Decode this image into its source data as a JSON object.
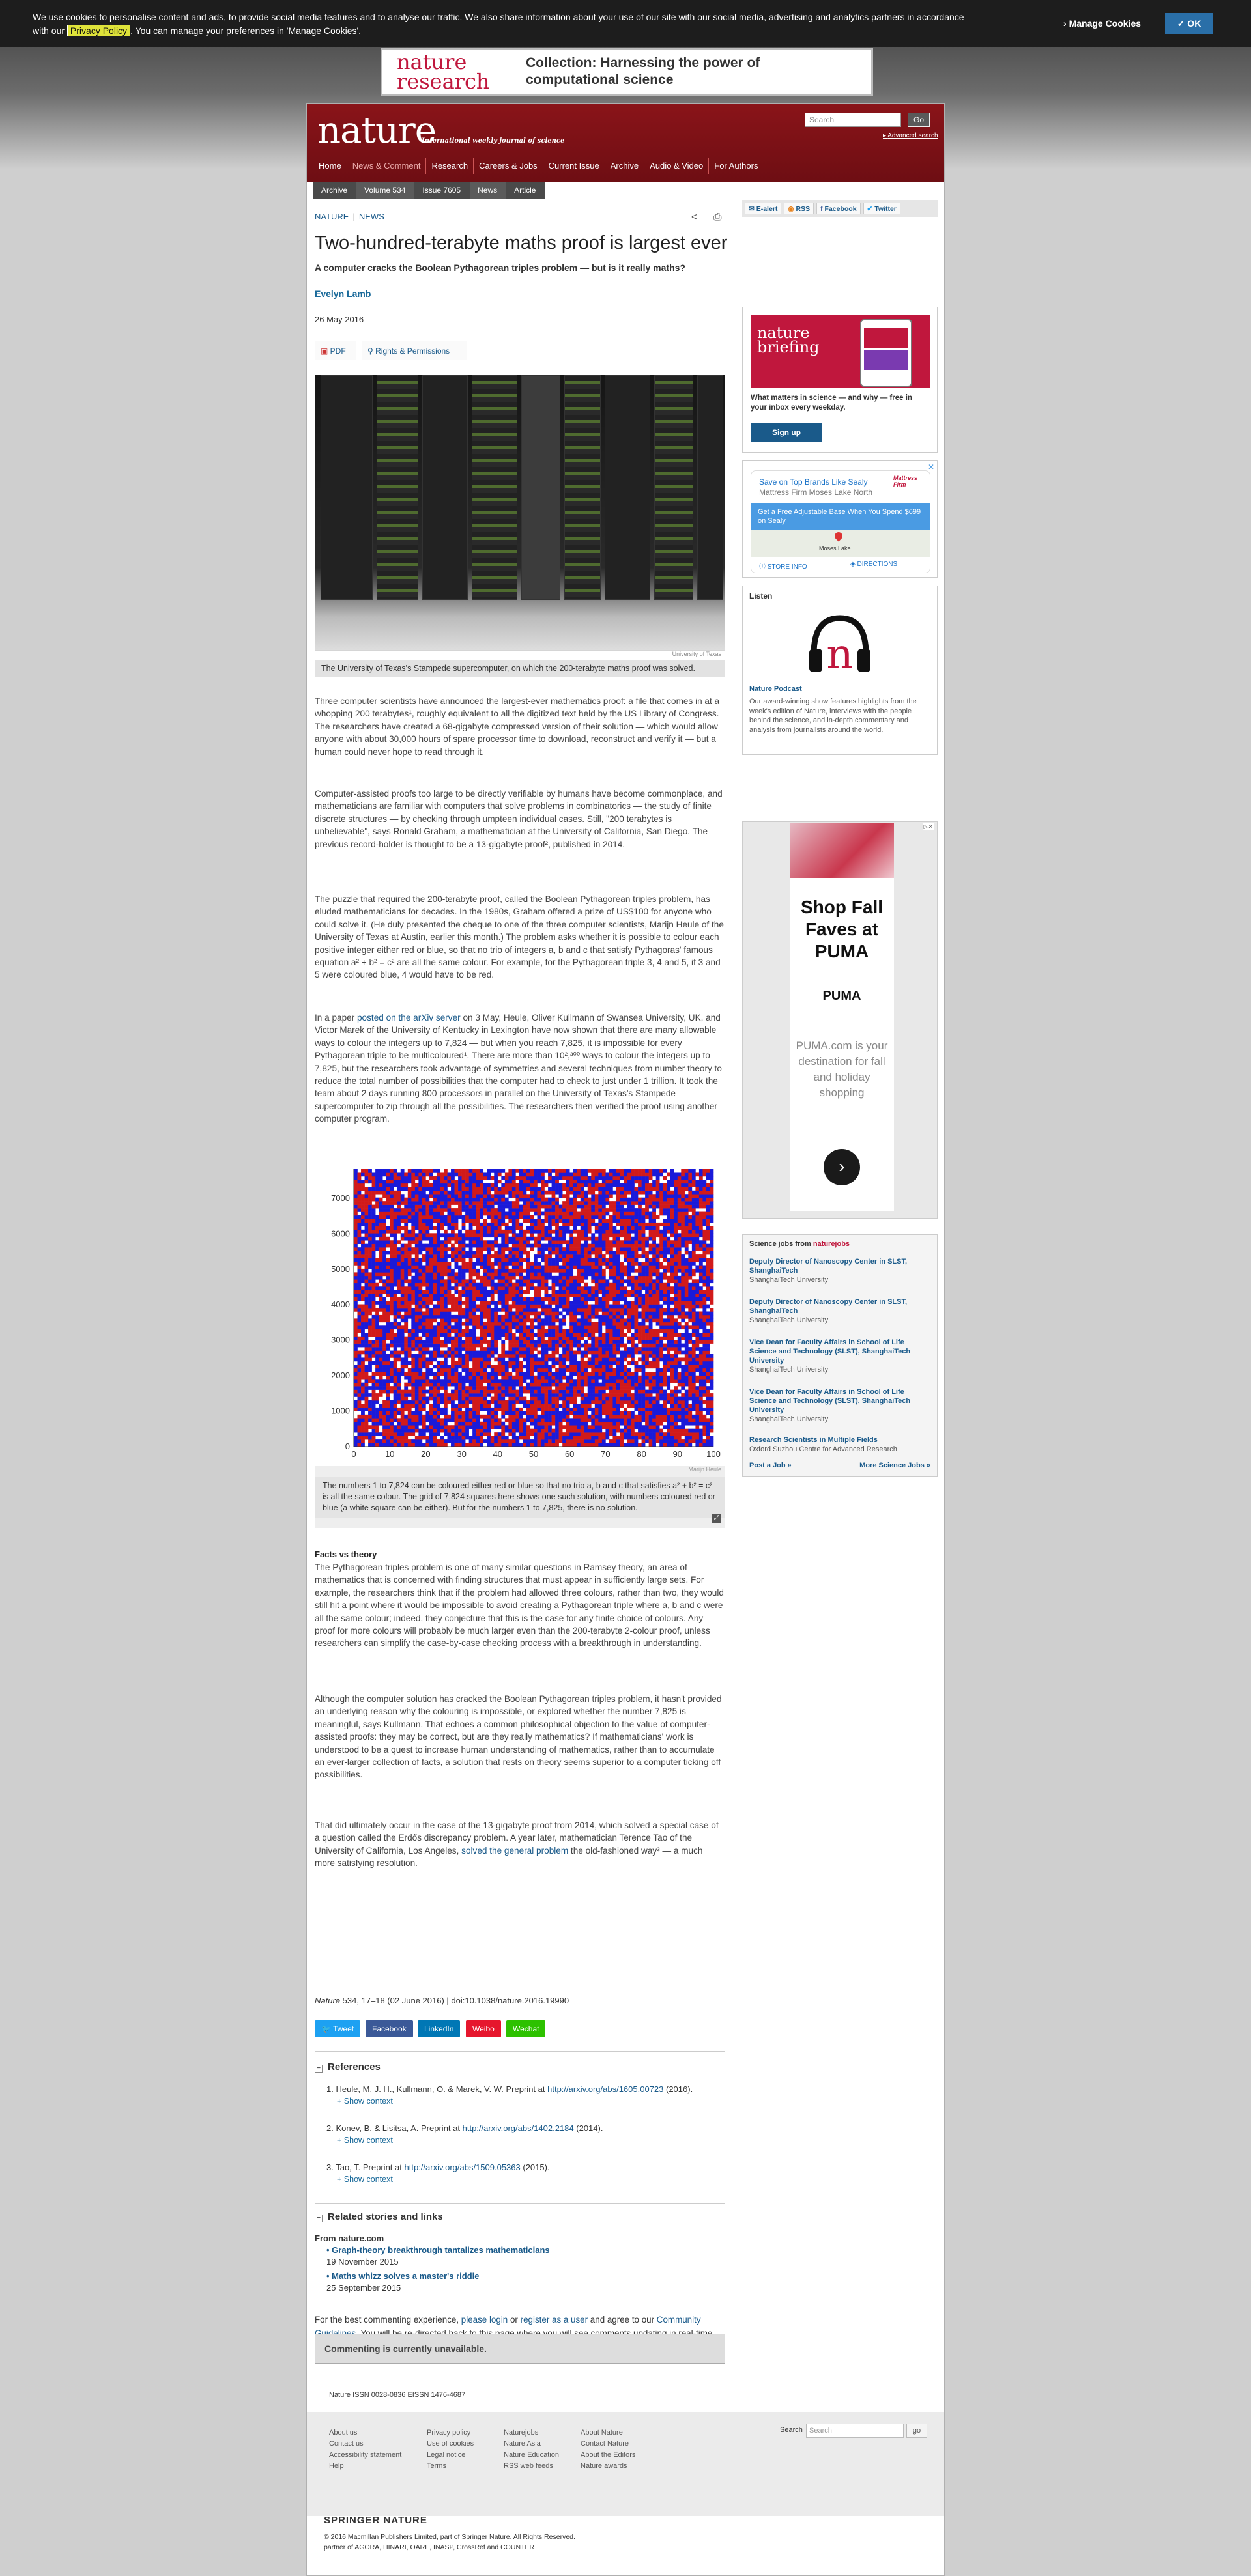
{
  "cookie": {
    "text_before": "We use cookies to personalise content and ads, to provide social media features and to analyse our traffic. We also share information about your use of our site with our social media, advertising and analytics partners in accordance with our ",
    "privacy_link": "Privacy Policy",
    "text_after": ". You can manage your preferences in 'Manage Cookies'.",
    "manage": "Manage Cookies",
    "ok": "✓ OK"
  },
  "banner": {
    "logo_line1": "nature",
    "logo_line2": "research",
    "message": "Collection: Harnessing the power of computational science"
  },
  "masthead": {
    "logo": "nature",
    "tagline": "International weekly journal of science",
    "search_placeholder": "Search",
    "go": "Go",
    "advanced": "Advanced search"
  },
  "nav": [
    "Home",
    "News & Comment",
    "Research",
    "Careers & Jobs",
    "Current Issue",
    "Archive",
    "Audio & Video",
    "For Authors"
  ],
  "breadcrumbs": [
    "Archive",
    "Volume 534",
    "Issue 7605",
    "News",
    "Article"
  ],
  "article": {
    "kicker1": "NATURE",
    "kicker2": "NEWS",
    "title": "Two-hundred-terabyte maths proof is largest ever",
    "standfirst": "A computer cracks the Boolean Pythagorean triples problem — but is it really maths?",
    "author": "Evelyn Lamb",
    "date": "26 May 2016",
    "pdf": "PDF",
    "rights": "Rights & Permissions",
    "image_credit": "University of Texas",
    "image_caption": "The University of Texas's Stampede supercomputer, on which the 200-terabyte maths proof was solved.",
    "p1": "Three computer scientists have announced the largest-ever mathematics proof: a file that comes in at a whopping 200 terabytes¹, roughly equivalent to all the digitized text held by the US Library of Congress. The researchers have created a 68-gigabyte compressed version of their solution — which would allow anyone with about 30,000 hours of spare processor time to download, reconstruct and verify it — but a human could never hope to read through it.",
    "p2": "Computer-assisted proofs too large to be directly verifiable by humans have become commonplace, and mathematicians are familiar with computers that solve problems in combinatorics — the study of finite discrete structures — by checking through umpteen individual cases. Still, \"200 terabytes is unbelievable\", says Ronald Graham, a mathematician at the University of California, San Diego. The previous record-holder is thought to be a 13-gigabyte proof², published in 2014.",
    "p3": "The puzzle that required the 200-terabyte proof, called the Boolean Pythagorean triples problem, has eluded mathematicians for decades. In the 1980s, Graham offered a prize of US$100 for anyone who could solve it. (He duly presented the cheque to one of the three computer scientists, Marijn Heule of the University of Texas at Austin, earlier this month.) The problem asks whether it is possible to colour each positive integer either red or blue, so that no trio of integers a, b and c that satisfy Pythagoras' famous equation a² + b² = c² are all the same colour. For example, for the Pythagorean triple 3, 4 and 5, if 3 and 5 were coloured blue, 4 would have to be red.",
    "p4_pre": "In a paper ",
    "p4_link": "posted on the arXiv server",
    "p4_post": " on 3 May, Heule, Oliver Kullmann of Swansea University, UK, and Victor Marek of the University of Kentucky in Lexington have now shown that there are many allowable ways to colour the integers up to 7,824 — but when you reach 7,825, it is impossible for every Pythagorean triple to be multicoloured¹. There are more than 10²,³⁰⁰ ways to colour the integers up to 7,825, but the researchers took advantage of symmetries and several techniques from number theory to reduce the total number of possibilities that the computer had to check to just under 1 trillion. It took the team about 2 days running 800 processors in parallel on the University of Texas's Stampede supercomputer to zip through all the possibilities. The researchers then verified the proof using another computer program.",
    "figure_credit": "Marijn Heule",
    "figure_caption": "The numbers 1 to 7,824 can be coloured either red or blue so that no trio a, b and c that satisfies a² + b² = c² is all the same colour. The grid of 7,824 squares here shows one such solution, with numbers coloured red or blue (a white square can be either). But for the numbers 1 to 7,825, there is no solution.",
    "facts_heading": "Facts vs theory",
    "p5": "The Pythagorean triples problem is one of many similar questions in Ramsey theory, an area of mathematics that is concerned with finding structures that must appear in sufficiently large sets. For example, the researchers think that if the problem had allowed three colours, rather than two, they would still hit a point where it would be impossible to avoid creating a Pythagorean triple where a, b and c were all the same colour; indeed, they conjecture that this is the case for any finite choice of colours. Any proof for more colours will probably be much larger even than the 200-terabyte 2-colour proof, unless researchers can simplify the case-by-case checking process with a breakthrough in understanding.",
    "p6": "Although the computer solution has cracked the Boolean Pythagorean triples problem, it hasn't provided an underlying reason why the colouring is impossible, or explored whether the number 7,825 is meaningful, says Kullmann. That echoes a common philosophical objection to the value of computer-assisted proofs: they may be correct, but are they really mathematics? If mathematicians' work is understood to be a quest to increase human understanding of mathematics, rather than to accumulate an ever-larger collection of facts, a solution that rests on theory seems superior to a computer ticking off possibilities.",
    "p7_pre": "That did ultimately occur in the case of the 13-gigabyte proof from 2014, which solved a special case of a question called the Erdős discrepancy problem. A year later, mathematician Terence Tao of the University of California, Los Angeles, ",
    "p7_link": "solved the general problem",
    "p7_post": " the old-fashioned way³ — a much more satisfying resolution.",
    "citation_journal": "Nature",
    "citation_rest": "534, 17–18 (02 June 2016) | doi:10.1038/nature.2016.19990",
    "share": [
      "Tweet",
      "Facebook",
      "LinkedIn",
      "Weibo",
      "Wechat"
    ]
  },
  "references": {
    "heading": "References",
    "show_context": "Show context",
    "items": [
      {
        "text": "Heule, M. J. H., Kullmann, O. & Marek, V. W. Preprint at ",
        "link": "http://arxiv.org/abs/1605.00723",
        "after": " (2016)."
      },
      {
        "text": "Konev, B. & Lisitsa, A. Preprint at ",
        "link": "http://arxiv.org/abs/1402.2184",
        "after": " (2014)."
      },
      {
        "text": "Tao, T. Preprint at ",
        "link": "http://arxiv.org/abs/1509.05363",
        "after": " (2015)."
      }
    ]
  },
  "related": {
    "heading": "Related stories and links",
    "from": "From nature.com",
    "items": [
      {
        "title": "Graph-theory breakthrough tantalizes mathematicians",
        "date": "19 November 2015"
      },
      {
        "title": "Maths whizz solves a master's riddle",
        "date": "25 September 2015"
      }
    ]
  },
  "comments": {
    "pre": "For the best commenting experience, ",
    "login": "please login",
    "or": " or ",
    "register": "register as a user",
    "mid": " and agree to our ",
    "guidelines": "Community Guidelines",
    "post": ". You will be re-directed back to this page where you will see comments updating in real-time and have the ability to recommend comments to other users.",
    "unavailable": "Commenting is currently unavailable."
  },
  "footer": {
    "issn": "Nature ISSN 0028-0836 EISSN 1476-4687",
    "col1": [
      "About us",
      "Contact us",
      "Accessibility statement",
      "Help"
    ],
    "col2": [
      "Privacy policy",
      "Use of cookies",
      "Legal notice",
      "Terms"
    ],
    "col3": [
      "Naturejobs",
      "Nature Asia",
      "Nature Education",
      "RSS web feeds"
    ],
    "col4": [
      "About Nature",
      "Contact Nature",
      "About the Editors",
      "Nature awards"
    ],
    "search_label": "Search",
    "search_placeholder": "Search",
    "go": "go",
    "springer": "SPRINGER NATURE",
    "copyright": "© 2016 Macmillan Publishers Limited, part of Springer Nature. All Rights Reserved.",
    "partners": "partner of AGORA, HINARI, OARE, INASP, CrossRef and COUNTER"
  },
  "sidebar": {
    "feeds": [
      "E-alert",
      "RSS",
      "Facebook",
      "Twitter"
    ],
    "briefing": {
      "logo1": "nature",
      "logo2": "briefing",
      "desc": "What matters in science — and why — free in your inbox every weekday.",
      "button": "Sign up"
    },
    "ad1": {
      "title": "Save on Top Brands Like Sealy",
      "subtitle": "Mattress Firm Moses Lake North",
      "brand": "Mattress Firm",
      "offer": "Get a Free Adjustable Base When You Spend $699 on Sealy",
      "map_label": "Moses Lake",
      "store": "STORE INFO",
      "directions": "DIRECTIONS"
    },
    "listen": {
      "heading": "Listen",
      "podcast": "Nature Podcast",
      "desc": "Our award-winning show features highlights from the week's edition of Nature, interviews with the people behind the science, and in-depth commentary and analysis from journalists around the world."
    },
    "ad2": {
      "headline": "Shop Fall Faves at PUMA",
      "brand": "PUMA",
      "body": "PUMA.com is your destination for fall and holiday shopping"
    },
    "jobs": {
      "heading_pre": "Science jobs from ",
      "heading_brand": "naturejobs",
      "items": [
        {
          "title": "Deputy Director of Nanoscopy Center in SLST, ShanghaiTech",
          "org": "ShanghaiTech University"
        },
        {
          "title": "Deputy Director of Nanoscopy Center in SLST, ShanghaiTech",
          "org": "ShanghaiTech University"
        },
        {
          "title": "Vice Dean for Faculty Affairs in School of Life Science and Technology (SLST), ShanghaiTech University",
          "org": "ShanghaiTech University"
        },
        {
          "title": "Vice Dean for Faculty Affairs in School of Life Science and Technology (SLST), ShanghaiTech University",
          "org": "ShanghaiTech University"
        },
        {
          "title": "Research Scientists in Multiple Fields",
          "org": "Oxford Suzhou Centre for Advanced Research"
        }
      ],
      "post": "Post a Job »",
      "more": "More Science Jobs »"
    }
  },
  "chart_data": {
    "type": "heatmap",
    "x_ticks": [
      0,
      10,
      20,
      30,
      40,
      50,
      60,
      70,
      80,
      90,
      100
    ],
    "y_ticks": [
      0,
      1000,
      2000,
      3000,
      4000,
      5000,
      6000,
      7000
    ],
    "xlim": [
      0,
      100
    ],
    "ylim": [
      0,
      7824
    ],
    "total_cells": 7824,
    "colors": {
      "red": "#d11a1a",
      "blue": "#1a1ad9",
      "white": "#ffffff"
    }
  }
}
